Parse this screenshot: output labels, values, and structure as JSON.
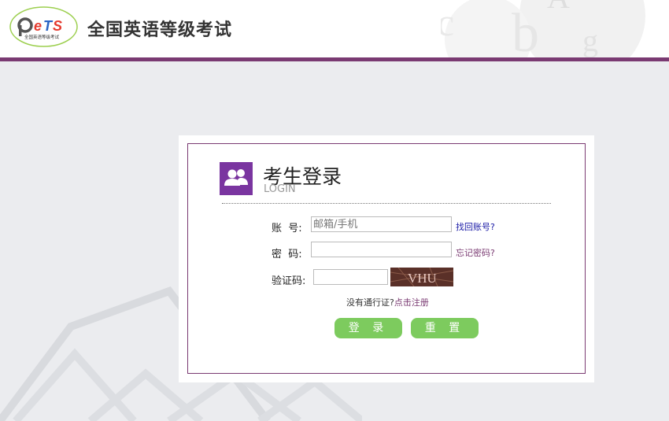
{
  "header": {
    "logo_text": "PETS",
    "logo_subtitle": "全国英语等级考试",
    "site_title": "全国英语等级考试"
  },
  "login": {
    "title": "考生登录",
    "subtitle": "LOGIN",
    "account_label": "账  号:",
    "account_placeholder": "邮箱/手机",
    "account_value": "",
    "find_account_link": "找回账号?",
    "password_label": "密  码:",
    "password_value": "",
    "forgot_password_link": "忘记密码?",
    "captcha_label": "验证码:",
    "captcha_value": "",
    "captcha_text": "VHU",
    "register_prompt": "没有通行证?",
    "register_link": "点击注册",
    "login_button": "登 录",
    "reset_button": "重 置"
  },
  "colors": {
    "brand_purple": "#7a3a72",
    "icon_purple": "#7a35a0",
    "button_green": "#7dcb5e",
    "link_blue": "#1a1aa6"
  }
}
